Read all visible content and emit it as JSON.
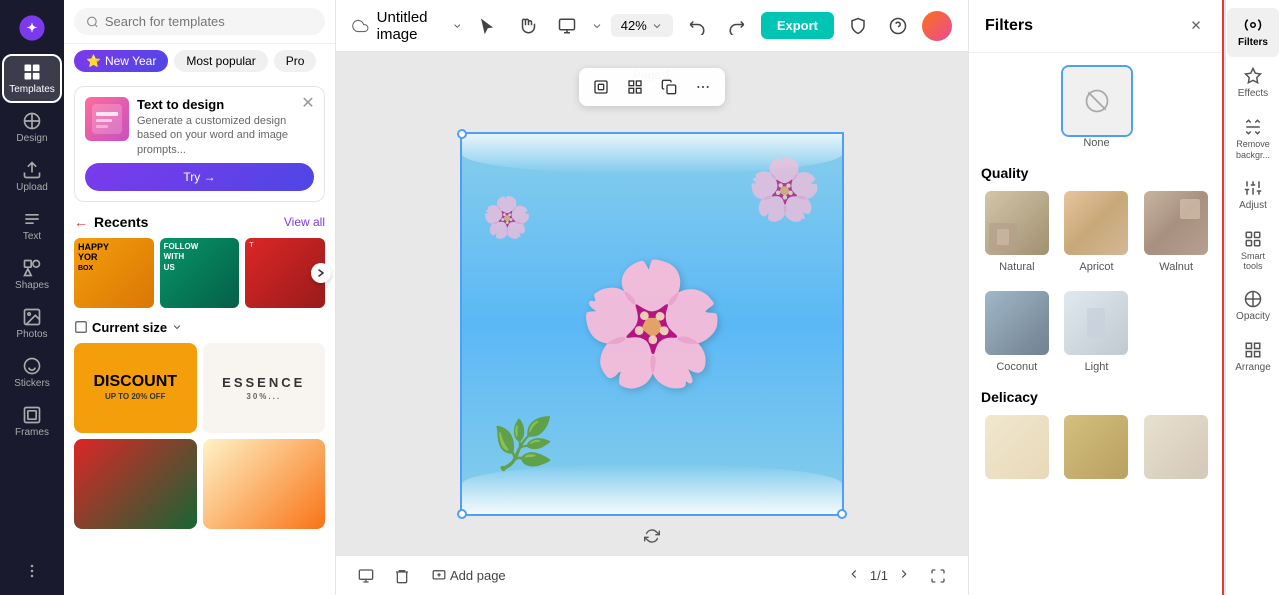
{
  "app": {
    "logo_alt": "Canva logo"
  },
  "sidebar": {
    "items": [
      {
        "id": "templates",
        "label": "Templates",
        "active": true
      },
      {
        "id": "design",
        "label": "Design"
      },
      {
        "id": "upload",
        "label": "Upload"
      },
      {
        "id": "text",
        "label": "Text"
      },
      {
        "id": "shapes",
        "label": "Shapes"
      },
      {
        "id": "photos",
        "label": "Photos"
      },
      {
        "id": "stickers",
        "label": "Stickers"
      },
      {
        "id": "frames",
        "label": "Frames"
      }
    ]
  },
  "left_panel": {
    "search_placeholder": "Search for templates",
    "filter_tabs": [
      {
        "id": "new-year",
        "label": "New Year",
        "starred": true
      },
      {
        "id": "most-popular",
        "label": "Most popular"
      },
      {
        "id": "pro",
        "label": "Pro"
      }
    ],
    "txt2design": {
      "title": "Text to design",
      "description": "Generate a customized design based on your word and image prompts...",
      "try_label": "Try →"
    },
    "recents": {
      "title": "Recents",
      "view_all": "View all"
    },
    "current_size": {
      "label": "Current size"
    }
  },
  "topbar": {
    "doc_title": "Untitled image",
    "zoom": "42%",
    "export_label": "Export"
  },
  "canvas": {
    "page_label": "Page 1"
  },
  "bottom_bar": {
    "add_page": "Add page",
    "page_current": "1/1"
  },
  "filters": {
    "title": "Filters",
    "none_label": "None",
    "quality_section": "Quality",
    "delicacy_section": "Delicacy",
    "items": [
      {
        "id": "natural",
        "label": "Natural"
      },
      {
        "id": "apricot",
        "label": "Apricot"
      },
      {
        "id": "walnut",
        "label": "Walnut"
      },
      {
        "id": "coconut",
        "label": "Coconut"
      },
      {
        "id": "light",
        "label": "Light"
      }
    ],
    "delicacy_items": [
      {
        "id": "d1",
        "label": ""
      },
      {
        "id": "d2",
        "label": ""
      },
      {
        "id": "d3",
        "label": ""
      }
    ]
  },
  "right_tools": [
    {
      "id": "filters",
      "label": "Filters",
      "active": true
    },
    {
      "id": "effects",
      "label": "Effects"
    },
    {
      "id": "remove-bg",
      "label": "Remove backgr..."
    },
    {
      "id": "adjust",
      "label": "Adjust"
    },
    {
      "id": "smart-tools",
      "label": "Smart tools"
    },
    {
      "id": "opacity",
      "label": "Opacity"
    },
    {
      "id": "arrange",
      "label": "Arrange"
    }
  ]
}
